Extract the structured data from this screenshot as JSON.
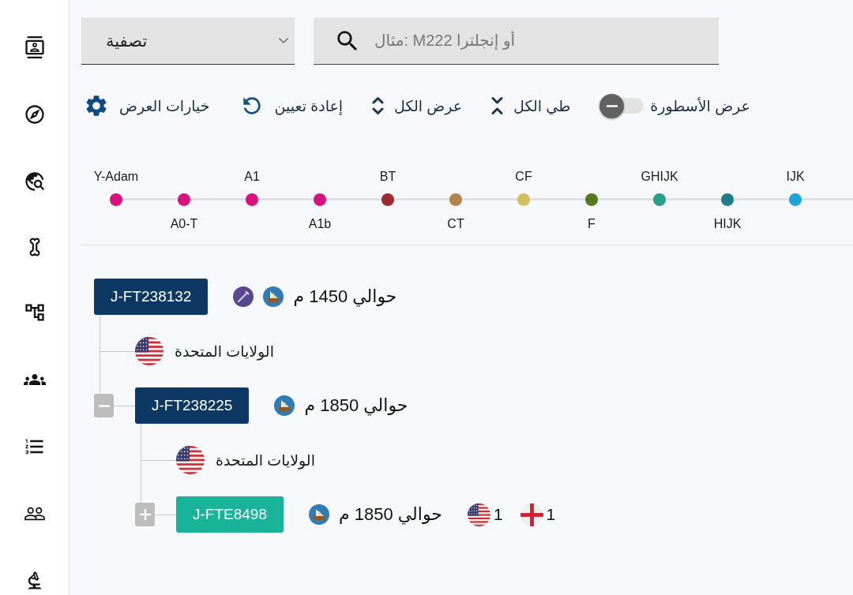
{
  "filter": {
    "label": "تصفية"
  },
  "search": {
    "placeholder": "مثال: M222 أو إنجلترا"
  },
  "toolbar": [
    {
      "kind": "toggle",
      "label": "عرض الأسطورة",
      "on": false
    },
    {
      "kind": "collapse",
      "label": "طي الكل"
    },
    {
      "kind": "expand",
      "label": "عرض الكل"
    },
    {
      "kind": "reset",
      "label": "إعادة تعيين"
    },
    {
      "kind": "options",
      "label": "خيارات العرض"
    }
  ],
  "timeline": [
    {
      "label": "Y-Adam",
      "color": "#d6137f"
    },
    {
      "label": "A0-T",
      "color": "#d6137f"
    },
    {
      "label": "A1",
      "color": "#d6137f"
    },
    {
      "label": "A1b",
      "color": "#d6137f"
    },
    {
      "label": "BT",
      "color": "#9a2b33"
    },
    {
      "label": "CT",
      "color": "#b3844c"
    },
    {
      "label": "CF",
      "color": "#d3bf60"
    },
    {
      "label": "F",
      "color": "#537a1e"
    },
    {
      "label": "GHIJK",
      "color": "#2a9d8f"
    },
    {
      "label": "HIJK",
      "color": "#1f7d85"
    },
    {
      "label": "IJK",
      "color": "#1ea5d8"
    }
  ],
  "tree": [
    {
      "name": "J-FT238132",
      "highlighted": false,
      "date": "حوالي 1450 م",
      "badges": [
        {
          "kind": "needle"
        },
        {
          "kind": "ship"
        }
      ],
      "countries": [
        {
          "kind": "us",
          "name": "الولايات المتحدة"
        }
      ],
      "children": [
        {
          "name": "J-FT238225",
          "highlighted": false,
          "expanded": true,
          "date": "حوالي 1850 م",
          "badges": [
            {
              "kind": "ship"
            }
          ],
          "countries": [
            {
              "kind": "us",
              "name": "الولايات المتحدة"
            }
          ],
          "children": [
            {
              "name": "J-FTE8498",
              "highlighted": true,
              "expanded": false,
              "date": "حوالي 1850 م",
              "badges": [
                {
                  "kind": "ship"
                }
              ],
              "counts": [
                {
                  "kind": "england",
                  "count": "1"
                },
                {
                  "kind": "us",
                  "count": "1"
                }
              ]
            }
          ]
        }
      ]
    }
  ]
}
